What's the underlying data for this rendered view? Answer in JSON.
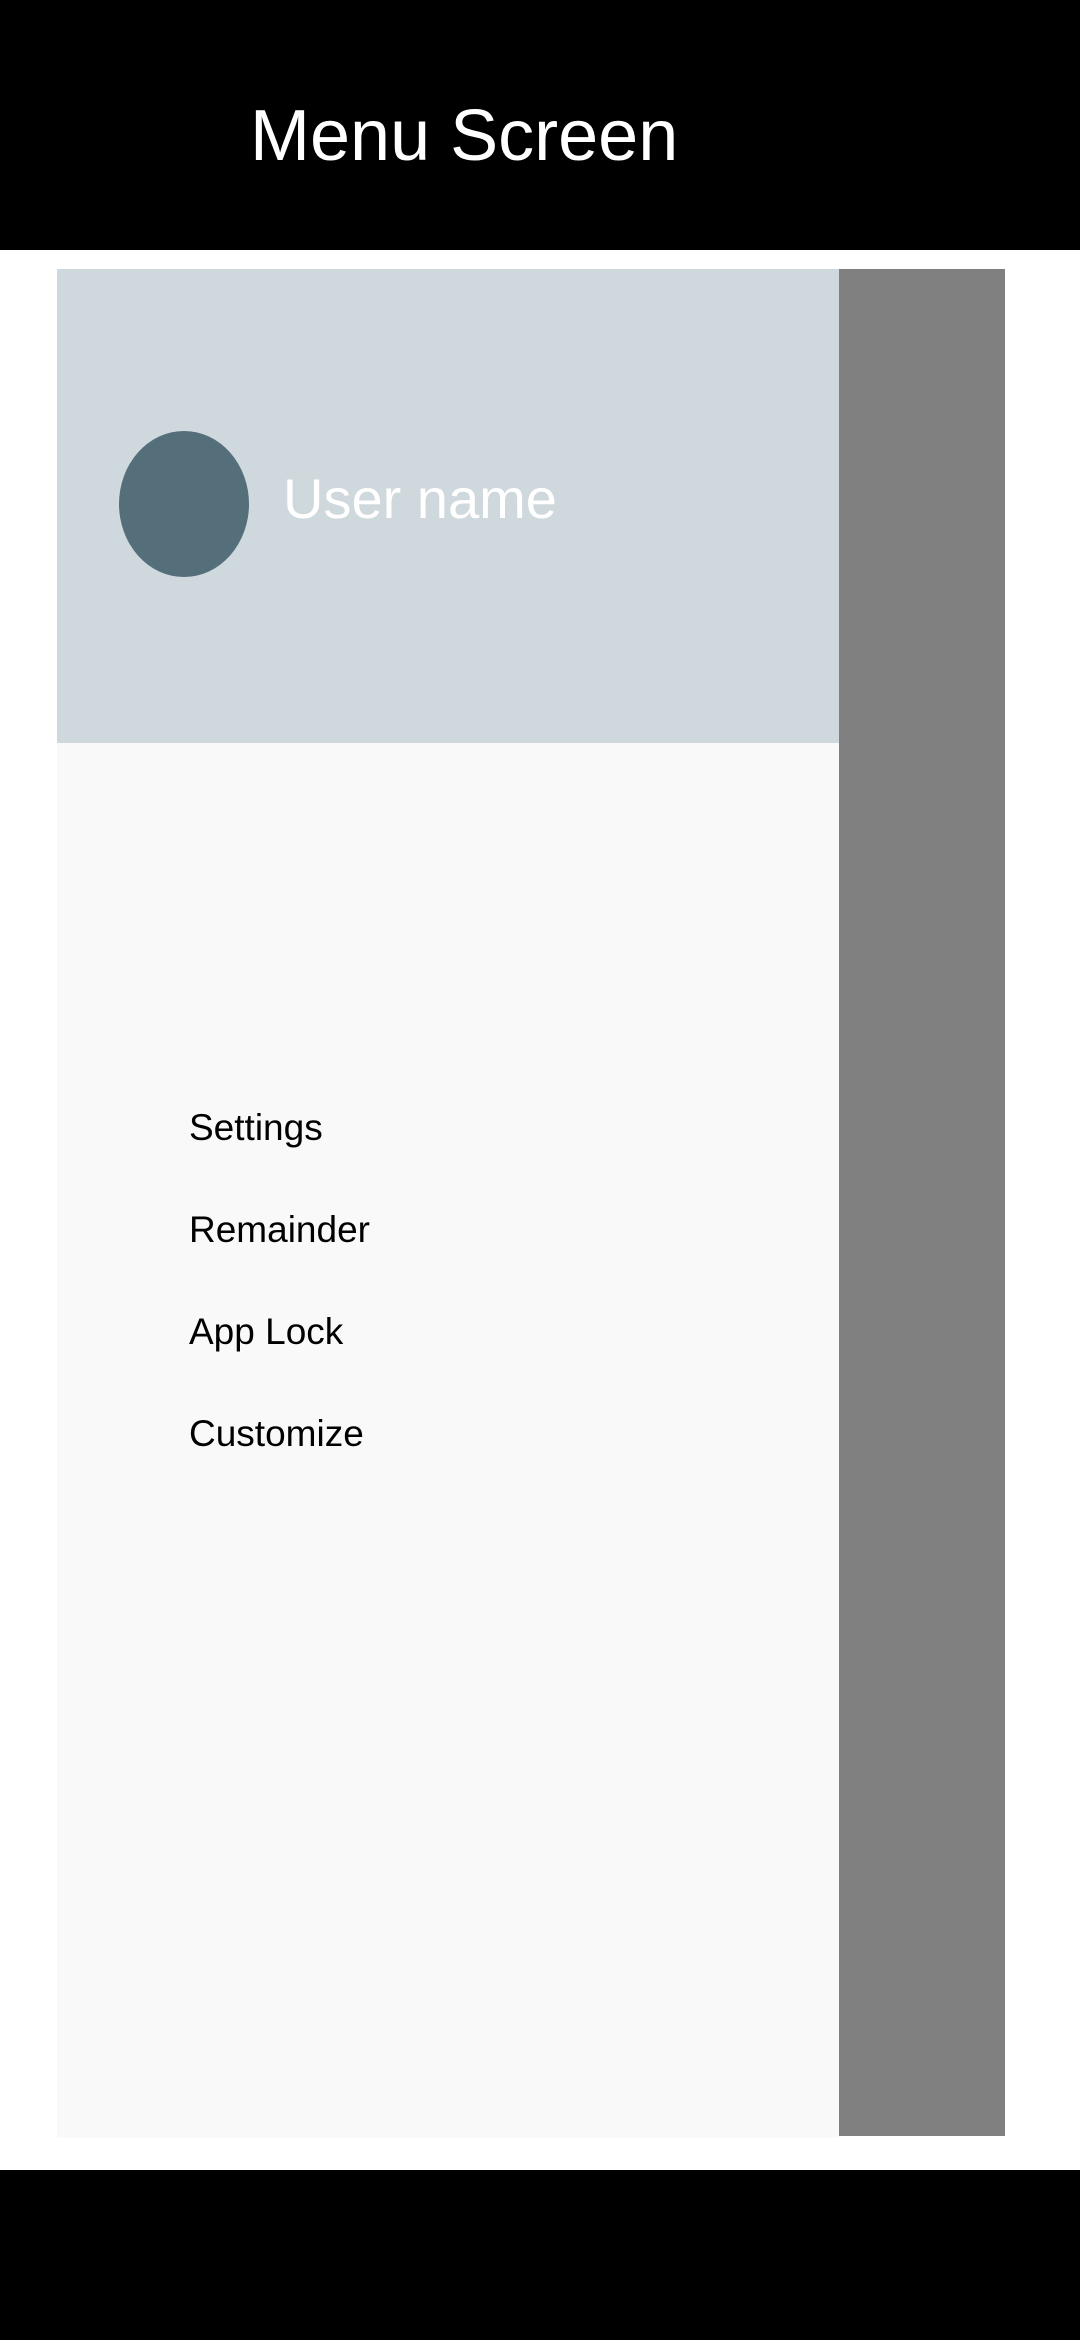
{
  "header": {
    "title": "Menu Screen"
  },
  "drawer": {
    "user_name": "User name",
    "items": [
      {
        "label": "Settings"
      },
      {
        "label": "Remainder"
      },
      {
        "label": "App Lock"
      },
      {
        "label": "Customize"
      }
    ]
  },
  "colors": {
    "header_background": "#cfd8dc",
    "avatar": "#546e7a",
    "drawer_background": "#f9f9f9",
    "scrim": "#808080",
    "frame": "#000000"
  }
}
